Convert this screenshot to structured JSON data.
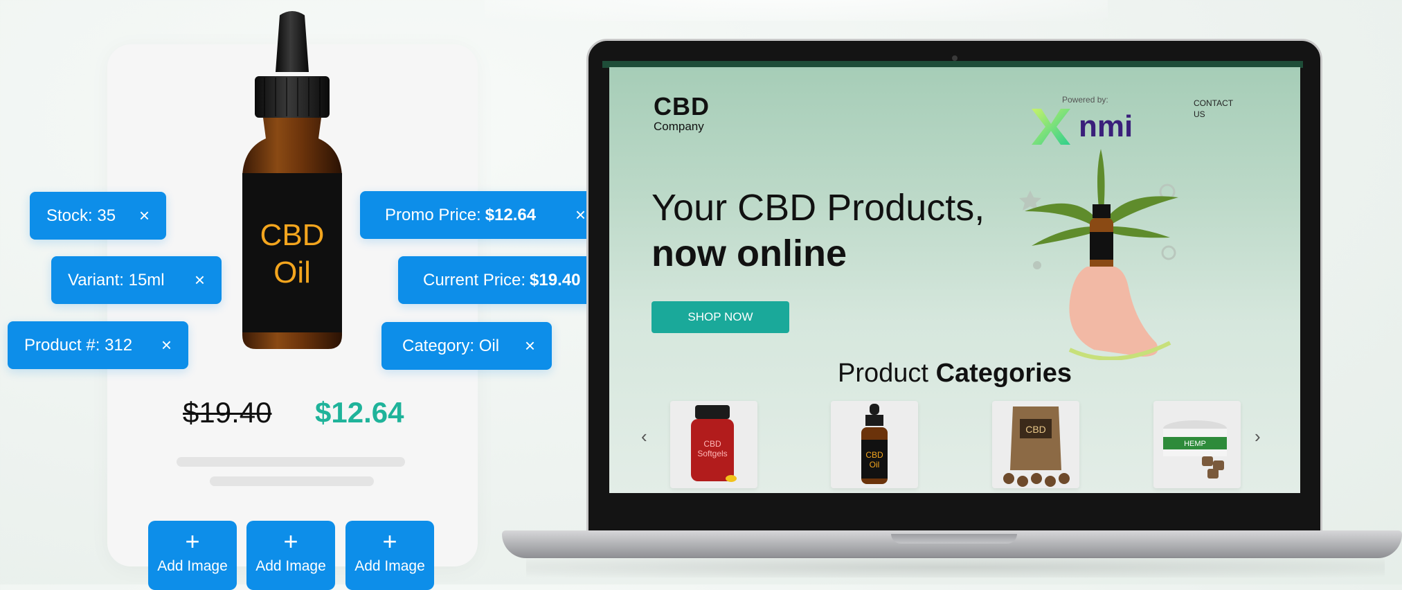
{
  "product_card": {
    "old_price": "$19.40",
    "new_price": "$12.64",
    "bottle_label": [
      "CBD",
      "Oil"
    ],
    "add_image_label": "Add Image",
    "add_image_icon": "plus-icon"
  },
  "tags": [
    {
      "label": "Stock: 35",
      "value": ""
    },
    {
      "label": "Variant: 15ml",
      "value": ""
    },
    {
      "label": "Product #: 312",
      "value": ""
    },
    {
      "label": "Promo Price:",
      "value": "$12.64"
    },
    {
      "label": "Current Price:",
      "value": "$19.40"
    },
    {
      "label": "Category: Oil",
      "value": ""
    }
  ],
  "tag_close": "×",
  "website": {
    "logo_title": "CBD",
    "logo_subtitle": "Company",
    "powered_by": "Powered by:",
    "partner_logo": "nmi",
    "contact": "CONTACT US",
    "headline_1": "Your CBD Products,",
    "headline_2": "now online",
    "cta": "SHOP NOW",
    "categories_light": "Product",
    "categories_bold": "Categories",
    "prev_arrow": "‹",
    "next_arrow": "›",
    "thumbs": [
      {
        "name": "softgels",
        "text": [
          "CBD",
          "Softgels"
        ]
      },
      {
        "name": "oil",
        "text": [
          "CBD",
          "Oil"
        ]
      },
      {
        "name": "pouch",
        "text": [
          "CBD"
        ]
      },
      {
        "name": "jar",
        "text": [
          "HEMP"
        ]
      }
    ]
  },
  "colors": {
    "accent_blue": "#0d8ee9",
    "price_green": "#1fb39a",
    "cta_teal": "#1aa99a"
  }
}
